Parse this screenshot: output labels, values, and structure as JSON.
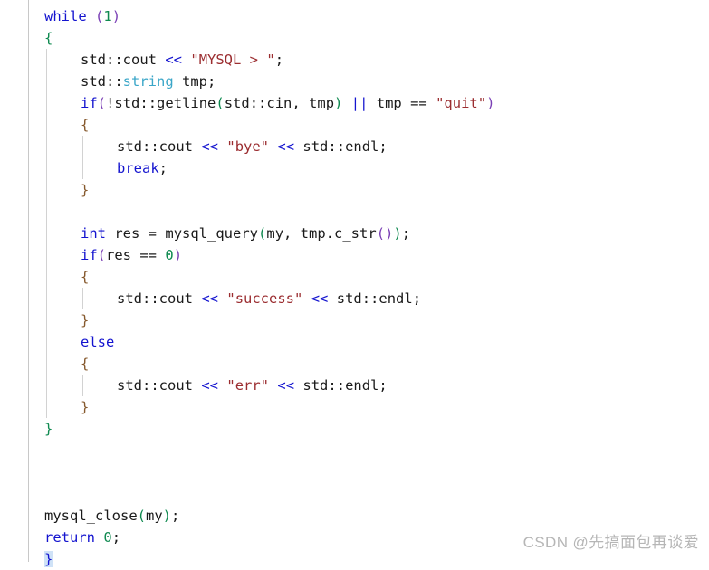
{
  "editor": {
    "language": "C++",
    "background_color": "#ffffff",
    "font_size_px": 15.5,
    "line_height_px": 24,
    "colors": {
      "keyword": "#1414cf",
      "type": "#3aa6c8",
      "string": "#9b2d30",
      "number": "#0f8a50",
      "identifier": "#1a1a1a",
      "brace_level_1": "#0f8a50",
      "brace_level_2": "#86592d",
      "brace_level_3": "#7a3fb5",
      "indent_guide": "#d2d2d2",
      "gutter_rule": "#c8c8c8",
      "selection": "#cfe2f7",
      "watermark": "#b6b6b6"
    },
    "lines": [
      {
        "indent": 0,
        "guides": [],
        "tokens": [
          {
            "t": "while",
            "c": "kw"
          },
          {
            "t": " ",
            "c": "op"
          },
          {
            "t": "(",
            "c": "paren-p"
          },
          {
            "t": "1",
            "c": "num"
          },
          {
            "t": ")",
            "c": "paren-p"
          }
        ]
      },
      {
        "indent": 0,
        "guides": [],
        "tokens": [
          {
            "t": "{",
            "c": "br-green"
          }
        ]
      },
      {
        "indent": 1,
        "guides": [
          "g1"
        ],
        "tokens": [
          {
            "t": "std",
            "c": "id"
          },
          {
            "t": "::",
            "c": "op"
          },
          {
            "t": "cout",
            "c": "id"
          },
          {
            "t": " ",
            "c": "op"
          },
          {
            "t": "<<",
            "c": "kw"
          },
          {
            "t": " ",
            "c": "op"
          },
          {
            "t": "\"MYSQL > \"",
            "c": "str"
          },
          {
            "t": ";",
            "c": "punc"
          }
        ]
      },
      {
        "indent": 1,
        "guides": [
          "g1"
        ],
        "tokens": [
          {
            "t": "std",
            "c": "id"
          },
          {
            "t": "::",
            "c": "op"
          },
          {
            "t": "string",
            "c": "type"
          },
          {
            "t": " tmp;",
            "c": "id"
          }
        ]
      },
      {
        "indent": 1,
        "guides": [
          "g1"
        ],
        "tokens": [
          {
            "t": "if",
            "c": "kw"
          },
          {
            "t": "(",
            "c": "paren-p"
          },
          {
            "t": "!",
            "c": "op"
          },
          {
            "t": "std",
            "c": "id"
          },
          {
            "t": "::",
            "c": "op"
          },
          {
            "t": "getline",
            "c": "fn"
          },
          {
            "t": "(",
            "c": "paren-g"
          },
          {
            "t": "std",
            "c": "id"
          },
          {
            "t": "::",
            "c": "op"
          },
          {
            "t": "cin",
            "c": "id"
          },
          {
            "t": ", tmp",
            "c": "id"
          },
          {
            "t": ")",
            "c": "paren-g"
          },
          {
            "t": " ",
            "c": "op"
          },
          {
            "t": "||",
            "c": "kw"
          },
          {
            "t": " tmp ",
            "c": "id"
          },
          {
            "t": "==",
            "c": "op"
          },
          {
            "t": " ",
            "c": "op"
          },
          {
            "t": "\"quit\"",
            "c": "str"
          },
          {
            "t": ")",
            "c": "paren-p"
          }
        ]
      },
      {
        "indent": 1,
        "guides": [
          "g1"
        ],
        "tokens": [
          {
            "t": "{",
            "c": "br-brown"
          }
        ]
      },
      {
        "indent": 2,
        "guides": [
          "g1",
          "g2"
        ],
        "tokens": [
          {
            "t": "std",
            "c": "id"
          },
          {
            "t": "::",
            "c": "op"
          },
          {
            "t": "cout",
            "c": "id"
          },
          {
            "t": " ",
            "c": "op"
          },
          {
            "t": "<<",
            "c": "kw"
          },
          {
            "t": " ",
            "c": "op"
          },
          {
            "t": "\"bye\"",
            "c": "str"
          },
          {
            "t": " ",
            "c": "op"
          },
          {
            "t": "<<",
            "c": "kw"
          },
          {
            "t": " ",
            "c": "op"
          },
          {
            "t": "std",
            "c": "id"
          },
          {
            "t": "::",
            "c": "op"
          },
          {
            "t": "endl",
            "c": "id"
          },
          {
            "t": ";",
            "c": "punc"
          }
        ]
      },
      {
        "indent": 2,
        "guides": [
          "g1",
          "g2"
        ],
        "tokens": [
          {
            "t": "break",
            "c": "kw"
          },
          {
            "t": ";",
            "c": "punc"
          }
        ]
      },
      {
        "indent": 1,
        "guides": [
          "g1"
        ],
        "tokens": [
          {
            "t": "}",
            "c": "br-brown"
          }
        ]
      },
      {
        "indent": 1,
        "guides": [
          "g1"
        ],
        "tokens": []
      },
      {
        "indent": 1,
        "guides": [
          "g1"
        ],
        "tokens": [
          {
            "t": "int",
            "c": "kw"
          },
          {
            "t": " res ",
            "c": "id"
          },
          {
            "t": "=",
            "c": "op"
          },
          {
            "t": " ",
            "c": "op"
          },
          {
            "t": "mysql_query",
            "c": "fn"
          },
          {
            "t": "(",
            "c": "paren-g"
          },
          {
            "t": "my, tmp.",
            "c": "id"
          },
          {
            "t": "c_str",
            "c": "fn"
          },
          {
            "t": "(",
            "c": "paren-p"
          },
          {
            "t": ")",
            "c": "paren-p"
          },
          {
            "t": ")",
            "c": "paren-g"
          },
          {
            "t": ";",
            "c": "punc"
          }
        ]
      },
      {
        "indent": 1,
        "guides": [
          "g1"
        ],
        "tokens": [
          {
            "t": "if",
            "c": "kw"
          },
          {
            "t": "(",
            "c": "paren-p"
          },
          {
            "t": "res ",
            "c": "id"
          },
          {
            "t": "==",
            "c": "op"
          },
          {
            "t": " ",
            "c": "op"
          },
          {
            "t": "0",
            "c": "num"
          },
          {
            "t": ")",
            "c": "paren-p"
          }
        ]
      },
      {
        "indent": 1,
        "guides": [
          "g1"
        ],
        "tokens": [
          {
            "t": "{",
            "c": "br-brown"
          }
        ]
      },
      {
        "indent": 2,
        "guides": [
          "g1",
          "g2"
        ],
        "tokens": [
          {
            "t": "std",
            "c": "id"
          },
          {
            "t": "::",
            "c": "op"
          },
          {
            "t": "cout",
            "c": "id"
          },
          {
            "t": " ",
            "c": "op"
          },
          {
            "t": "<<",
            "c": "kw"
          },
          {
            "t": " ",
            "c": "op"
          },
          {
            "t": "\"success\"",
            "c": "str"
          },
          {
            "t": " ",
            "c": "op"
          },
          {
            "t": "<<",
            "c": "kw"
          },
          {
            "t": " ",
            "c": "op"
          },
          {
            "t": "std",
            "c": "id"
          },
          {
            "t": "::",
            "c": "op"
          },
          {
            "t": "endl",
            "c": "id"
          },
          {
            "t": ";",
            "c": "punc"
          }
        ]
      },
      {
        "indent": 1,
        "guides": [
          "g1"
        ],
        "tokens": [
          {
            "t": "}",
            "c": "br-brown"
          }
        ]
      },
      {
        "indent": 1,
        "guides": [
          "g1"
        ],
        "tokens": [
          {
            "t": "else",
            "c": "kw"
          }
        ]
      },
      {
        "indent": 1,
        "guides": [
          "g1"
        ],
        "tokens": [
          {
            "t": "{",
            "c": "br-brown"
          }
        ]
      },
      {
        "indent": 2,
        "guides": [
          "g1",
          "g2"
        ],
        "tokens": [
          {
            "t": "std",
            "c": "id"
          },
          {
            "t": "::",
            "c": "op"
          },
          {
            "t": "cout",
            "c": "id"
          },
          {
            "t": " ",
            "c": "op"
          },
          {
            "t": "<<",
            "c": "kw"
          },
          {
            "t": " ",
            "c": "op"
          },
          {
            "t": "\"err\"",
            "c": "str"
          },
          {
            "t": " ",
            "c": "op"
          },
          {
            "t": "<<",
            "c": "kw"
          },
          {
            "t": " ",
            "c": "op"
          },
          {
            "t": "std",
            "c": "id"
          },
          {
            "t": "::",
            "c": "op"
          },
          {
            "t": "endl",
            "c": "id"
          },
          {
            "t": ";",
            "c": "punc"
          }
        ]
      },
      {
        "indent": 1,
        "guides": [
          "g1"
        ],
        "tokens": [
          {
            "t": "}",
            "c": "br-brown"
          }
        ]
      },
      {
        "indent": 0,
        "guides": [],
        "tokens": [
          {
            "t": "}",
            "c": "br-green"
          }
        ]
      },
      {
        "indent": 0,
        "guides": [],
        "tokens": []
      },
      {
        "indent": 0,
        "guides": [],
        "tokens": []
      },
      {
        "indent": 0,
        "guides": [],
        "tokens": []
      },
      {
        "indent": 0,
        "guides": [],
        "tokens": [
          {
            "t": "mysql_close",
            "c": "fn"
          },
          {
            "t": "(",
            "c": "paren-g"
          },
          {
            "t": "my",
            "c": "id"
          },
          {
            "t": ")",
            "c": "paren-g"
          },
          {
            "t": ";",
            "c": "punc"
          }
        ]
      },
      {
        "indent": 0,
        "guides": [],
        "tokens": [
          {
            "t": "return",
            "c": "kw"
          },
          {
            "t": " ",
            "c": "op"
          },
          {
            "t": "0",
            "c": "num"
          },
          {
            "t": ";",
            "c": "punc"
          }
        ]
      },
      {
        "indent": 0,
        "guides": [],
        "selected": true,
        "tokens": [
          {
            "t": "}",
            "c": "kw"
          }
        ]
      }
    ]
  },
  "watermark": {
    "text": "CSDN @先搞面包再谈爱"
  }
}
